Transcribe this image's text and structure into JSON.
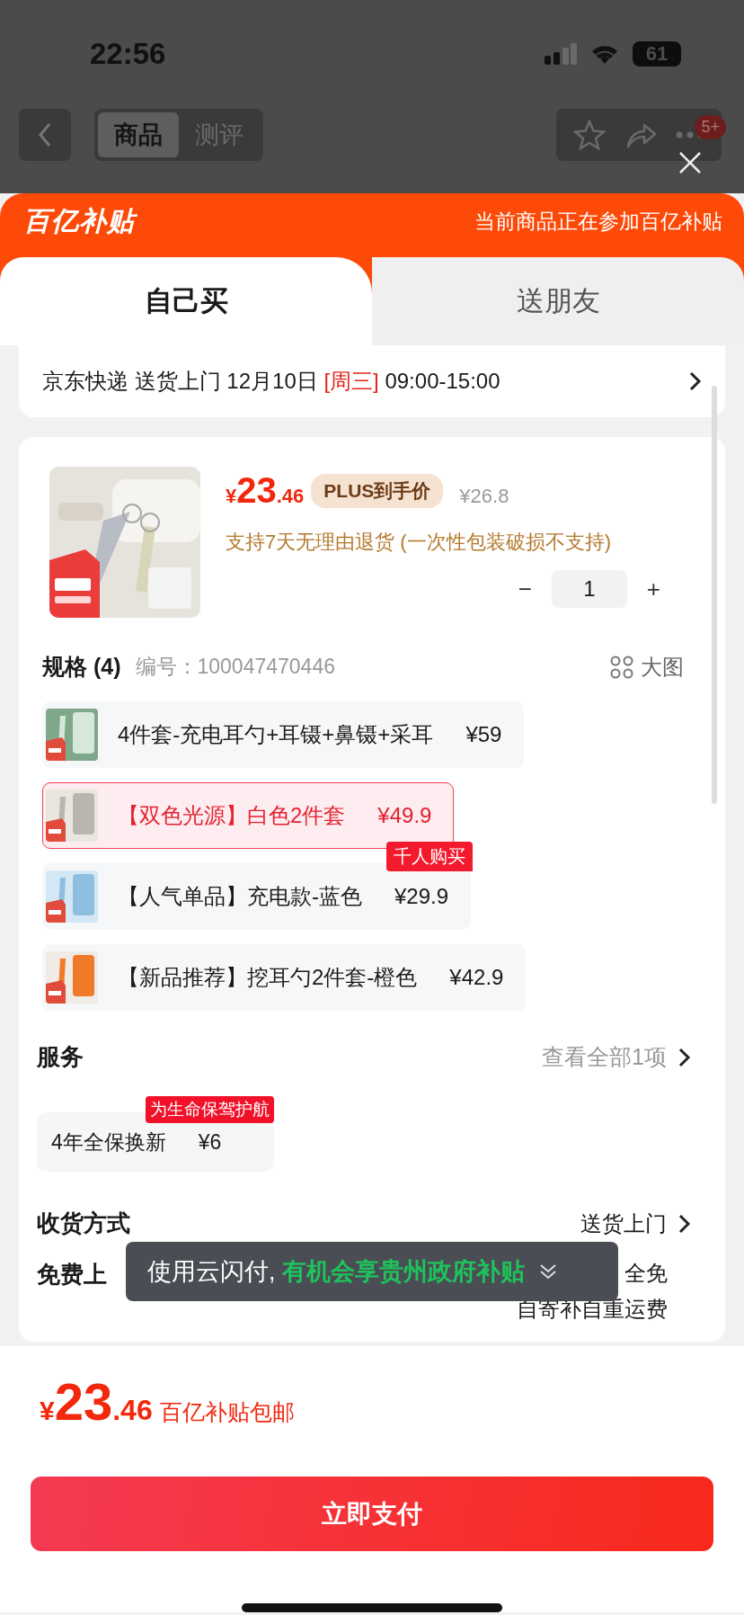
{
  "status_bar": {
    "time": "22:56",
    "battery": "61"
  },
  "nav": {
    "tabs": [
      {
        "label": "商品",
        "selected": true
      },
      {
        "label": "测评",
        "selected": false
      }
    ],
    "badge": "5+"
  },
  "sheet": {
    "logo": "百亿补贴",
    "banner_text": "当前商品正在参加百亿补贴",
    "tabs": [
      {
        "label": "自己买",
        "selected": true
      },
      {
        "label": "送朋友",
        "selected": false
      }
    ]
  },
  "delivery": {
    "segments": [
      {
        "text": "京东快递 送货上门 12月10日 ",
        "highlight": false
      },
      {
        "text": "[周三]",
        "highlight": true
      },
      {
        "text": " 09:00-15:00",
        "highlight": false
      }
    ]
  },
  "product": {
    "currency": "¥",
    "price_int": "23",
    "price_dec": ".46",
    "plus_label": "PLUS到手价",
    "original_price": "¥26.8",
    "return_policy": "支持7天无理由退货 (一次性包装破损不支持)",
    "minus": "−",
    "quantity": "1",
    "plus": "+"
  },
  "specs": {
    "title": "规格 (4)",
    "sku_label": "编号：",
    "sku": "100047470446",
    "big_image": "大图",
    "options": [
      {
        "label": "4件套-充电耳勺+耳镊+鼻镊+采耳",
        "price": "¥59",
        "selected": false
      },
      {
        "label": "【双色光源】白色2件套",
        "price": "¥49.9",
        "selected": true
      },
      {
        "label": "【人气单品】充电款-蓝色",
        "price": "¥29.9",
        "selected": false,
        "badge": "千人购买"
      },
      {
        "label": "【新品推荐】挖耳勺2件套-橙色",
        "price": "¥42.9",
        "selected": false
      }
    ]
  },
  "services": {
    "title": "服务",
    "view_all": "查看全部1项",
    "items": [
      {
        "label": "4年全保换新",
        "price": "¥6",
        "badge": "为生命保驾护航"
      }
    ]
  },
  "receive": {
    "title": "收货方式",
    "value": "送货上门"
  },
  "free_pickup": {
    "title": "免费上",
    "note_line1": "全免",
    "note_line2": "自寄补自重运费"
  },
  "toast": {
    "segments": [
      {
        "text": "使用云闪付, ",
        "highlight": false
      },
      {
        "text": "有机会享贵州政府补贴",
        "highlight": true
      }
    ]
  },
  "footer": {
    "currency": "¥",
    "price_int": "23",
    "price_dec": ".46",
    "note": "百亿补贴包邮",
    "pay_button": "立即支付"
  }
}
